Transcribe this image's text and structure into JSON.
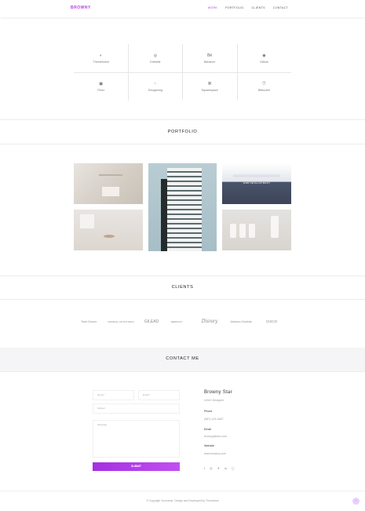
{
  "nav": {
    "brand": "BROWNY",
    "items": [
      "WORK",
      "PORTFOLIO",
      "CLIENTS",
      "CONTACT"
    ],
    "active": 0,
    "accent": "#b13ce6"
  },
  "social": [
    {
      "label": "Themeforest",
      "icon": "themeforest-icon",
      "glyph": "◐"
    },
    {
      "label": "Dribbble",
      "icon": "dribbble-icon",
      "glyph": "◎"
    },
    {
      "label": "Behance",
      "icon": "behance-icon",
      "glyph": "Bē"
    },
    {
      "label": "Github",
      "icon": "github-icon",
      "glyph": "◉"
    },
    {
      "label": "Flickr",
      "icon": "flickr-icon",
      "glyph": "▣"
    },
    {
      "label": "Smugmung",
      "icon": "smugmug-icon",
      "glyph": "⁘"
    },
    {
      "label": "Squarespace",
      "icon": "squarespace-icon",
      "glyph": "⌘"
    },
    {
      "label": "Bitbucket",
      "icon": "bitbucket-icon",
      "glyph": "⛉"
    }
  ],
  "sections": {
    "portfolio": "PORTFOLIO",
    "clients": "CLIENTS",
    "contact": "CONTACT ME"
  },
  "portfolio": {
    "overlay_caption": "WEB DEVELOPMENT"
  },
  "clients": [
    "Trust Grocer",
    "MONDIAL OUTFITTERS",
    "GILEAD",
    "WEBSOFT",
    "Disney",
    "Johnson Controls",
    "CISCO"
  ],
  "contact": {
    "name_placeholder": "Name*",
    "email_placeholder": "Email*",
    "subject_placeholder": "Subject",
    "message_placeholder": "Message",
    "submit": "SUBMIT",
    "person": "Browny Star",
    "role": "UI/UX Designer",
    "phone_label": "Phone",
    "phone": "(987) 123-4567",
    "email_label": "Email",
    "email": "browny@info.com",
    "website_label": "Website",
    "website": "www.browny.com",
    "social_icons": [
      "facebook-icon",
      "dribbble-icon",
      "twitter-icon",
      "linkedin-icon",
      "instagram-icon"
    ]
  },
  "footer": {
    "text": "© Copyright Yourname. Design and Developed by Themesine"
  }
}
